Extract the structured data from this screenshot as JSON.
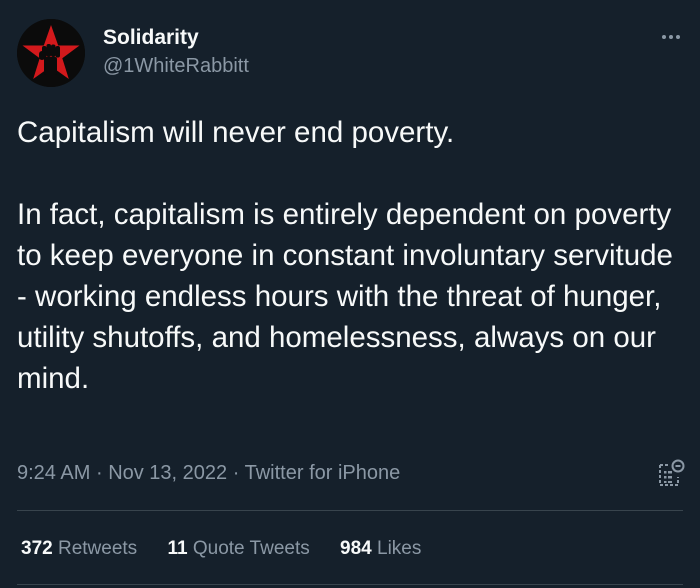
{
  "author": {
    "display_name": "Solidarity",
    "handle": "@1WhiteRabbitt"
  },
  "tweet": {
    "text": "Capitalism will never end poverty.\n\nIn fact, capitalism is entirely dependent on poverty to keep everyone in constant involuntary servitude - working endless hours with the threat of hunger, utility shutoffs, and homelessness, always on our mind."
  },
  "meta": {
    "time": "9:24 AM",
    "date": "Nov 13, 2022",
    "source": "Twitter for iPhone",
    "separator": "·"
  },
  "stats": {
    "retweets_count": "372",
    "retweets_label": "Retweets",
    "quotes_count": "11",
    "quotes_label": "Quote Tweets",
    "likes_count": "984",
    "likes_label": "Likes"
  },
  "colors": {
    "background": "#15202b",
    "text_primary": "#f7f9f9",
    "text_secondary": "#8b98a5",
    "divider": "#38444d",
    "avatar_star": "#d3191c"
  },
  "icons": {
    "avatar": "red-star-raised-fist",
    "more": "more-horizontal-icon",
    "analytics": "analytics-icon"
  }
}
